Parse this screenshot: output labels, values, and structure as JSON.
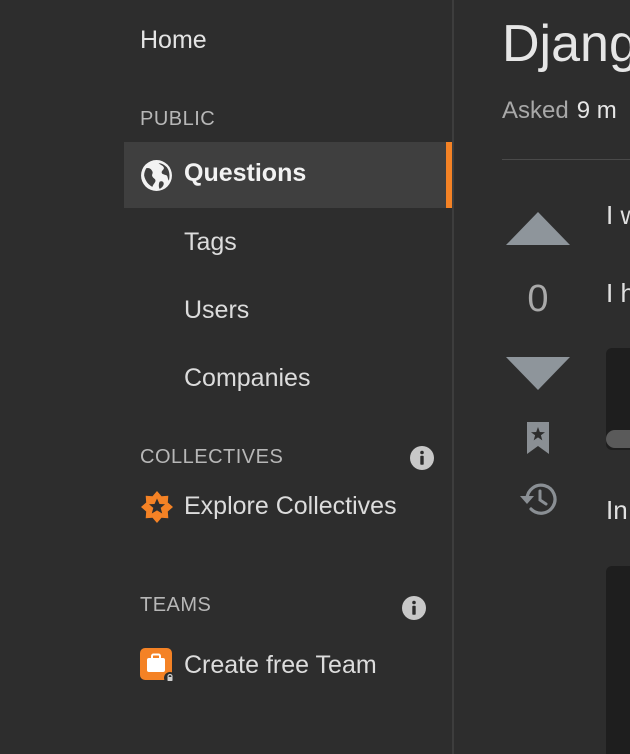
{
  "sidebar": {
    "home": "Home",
    "public_label": "PUBLIC",
    "active_item": "Questions",
    "items": [
      "Tags",
      "Users",
      "Companies"
    ],
    "collectives_label": "COLLECTIVES",
    "explore_collectives": "Explore Collectives",
    "teams_label": "TEAMS",
    "create_team": "Create free Team",
    "accent_color": "#f48225"
  },
  "question": {
    "title": "Djang",
    "asked_label": "Asked",
    "asked_value": "9 m",
    "vote_count": "0",
    "para1": "I w",
    "para2": "I h",
    "para3": "In"
  }
}
